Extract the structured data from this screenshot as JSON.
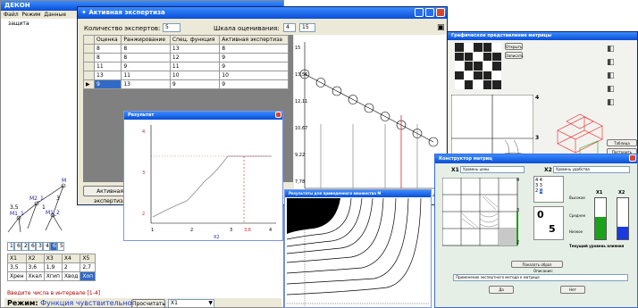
{
  "main": {
    "title": "ДЕКОН",
    "menu": [
      "Файл",
      "Режим",
      "Данные"
    ],
    "sub_label": "защита",
    "row_numbers": [
      "1",
      "6",
      "2",
      "6",
      "3",
      "4",
      "6",
      "5"
    ],
    "x_headers": [
      "X1",
      "X2",
      "X3",
      "X4",
      "X5"
    ],
    "x_values": [
      "3,5",
      "3,6",
      "1,9",
      "2",
      "2,7"
    ],
    "x_labels": [
      "Хрен",
      "Хкал",
      "Хгип",
      "Хвод",
      "Хоп"
    ],
    "hint": "Введите числа в интервале [1-4]",
    "mode_label": "Режим:",
    "mode_value": "Функция чувствительности",
    "calc_button": "Просчитать",
    "select_value": "X1",
    "tree": {
      "root": "M",
      "n3": "3",
      "m1": "M1_1",
      "m2": "M2_1",
      "m3": "M1_2",
      "v35": "3,5",
      "v1": "1"
    }
  },
  "expertise": {
    "title": "Активная экспертиза",
    "count_label": "Количество экспертов:",
    "count_value": "5",
    "scale_label": "Шкала оценивания:",
    "scale_from": "4",
    "scale_to": "15",
    "headers": [
      "Оценка",
      "Ранжирование",
      "Спец. функция",
      "Активная экспертиза"
    ],
    "rows": [
      [
        "8",
        "8",
        "13",
        "8"
      ],
      [
        "8",
        "8",
        "12",
        "9"
      ],
      [
        "11",
        "9",
        "11",
        "9"
      ],
      [
        "13",
        "11",
        "10",
        "10"
      ],
      [
        "9",
        "13",
        "9",
        "9"
      ]
    ],
    "button": "Активная экспертиза",
    "chart_y_ticks": [
      "15",
      "13,56",
      "12,11",
      "10,67",
      "9,22",
      "7,78"
    ],
    "chart_x_ticks": [
      "0",
      "1",
      "2",
      "3",
      "4"
    ]
  },
  "result_window": {
    "title": "Результат",
    "y_ticks": [
      "4",
      "3",
      "2"
    ],
    "x_ticks": [
      "1",
      "2",
      "3",
      "4"
    ],
    "xlabel": "X2",
    "marker": "3,6"
  },
  "graphics_window": {
    "title": "Графическое представление матрицы",
    "btn_open": "Открыть",
    "btn_save": "Записать",
    "axis_4": "4",
    "axis_3": "3",
    "axis_2": "2",
    "side_btn1": "Таблица",
    "side_btn2": "Построить"
  },
  "contour_window": {
    "title": "Результаты для приведенного множества M"
  },
  "constructor": {
    "title": "Конструктор матриц",
    "x1_label": "X1",
    "x1_field": "Уровень цены",
    "x2_label": "X2",
    "x2_field": "Уровень удобства",
    "level_high": "Высокое",
    "level_mid": "Среднее",
    "level_low": "Низкое",
    "bar_x1": "X1",
    "bar_x2": "X2",
    "bar_x1_value": 0.55,
    "bar_x2_value": 0.3,
    "level_text": "Текущий уровень влияния",
    "big_zero": "0",
    "big_five": "5",
    "desc_label": "Описание:",
    "desc_text": "Применение экспертного метода к матрице",
    "btn_show": "Показать образ",
    "btn_ok": "Да",
    "btn_no": "Нет",
    "num_labels": [
      "4",
      "3",
      "2",
      "1"
    ],
    "matrix_nums": [
      "4",
      "4",
      "3",
      "3",
      "2",
      "1"
    ]
  },
  "colors": {
    "title_bar": "#0a4ed6",
    "selected_row": "#316ac5",
    "bar_green": "#1aa31a",
    "bar_blue": "#1a3ae0",
    "dashed_red": "#d22"
  }
}
